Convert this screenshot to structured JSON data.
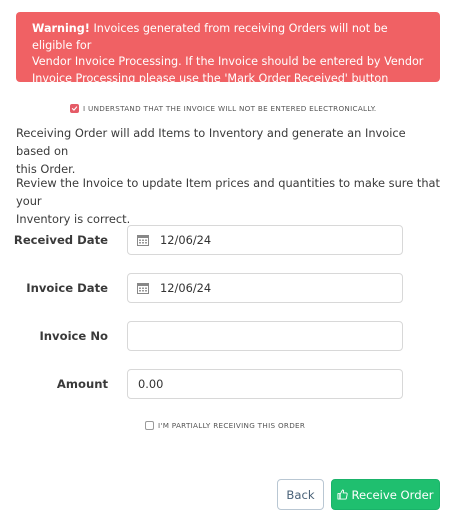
{
  "warning": {
    "strong": "Warning!",
    "line1": " Invoices generated from receiving Orders will not be eligible for",
    "line2": "Vendor Invoice Processing. If the Invoice should be entered by Vendor",
    "line3": "Invoice Processing please use the 'Mark Order Received' button instead."
  },
  "acknowledge": {
    "label": "I UNDERSTAND THAT THE INVOICE WILL NOT BE ENTERED ELECTRONICALLY.",
    "checked": true
  },
  "intro": {
    "p1_line1": "Receiving Order will add Items to Inventory and generate an Invoice based on",
    "p1_line2": "this Order.",
    "p2_line1": "Review the Invoice to update Item prices and quantities to make sure that your",
    "p2_line2": "Inventory is correct."
  },
  "form": {
    "received_date": {
      "label": "Received Date",
      "value": "12/06/24",
      "icon": "calendar-icon"
    },
    "invoice_date": {
      "label": "Invoice Date",
      "value": "12/06/24",
      "icon": "calendar-icon"
    },
    "invoice_no": {
      "label": "Invoice No",
      "value": ""
    },
    "amount": {
      "label": "Amount",
      "value": "0.00"
    }
  },
  "partial": {
    "label": "I'M PARTIALLY RECEIVING THIS ORDER",
    "checked": false
  },
  "buttons": {
    "back": "Back",
    "receive": "Receive Order",
    "receive_icon": "thumbs-up-icon"
  },
  "colors": {
    "warning_bg": "#f06164",
    "receive_bg": "#1fbf6f",
    "check_on": "#e55b67"
  }
}
